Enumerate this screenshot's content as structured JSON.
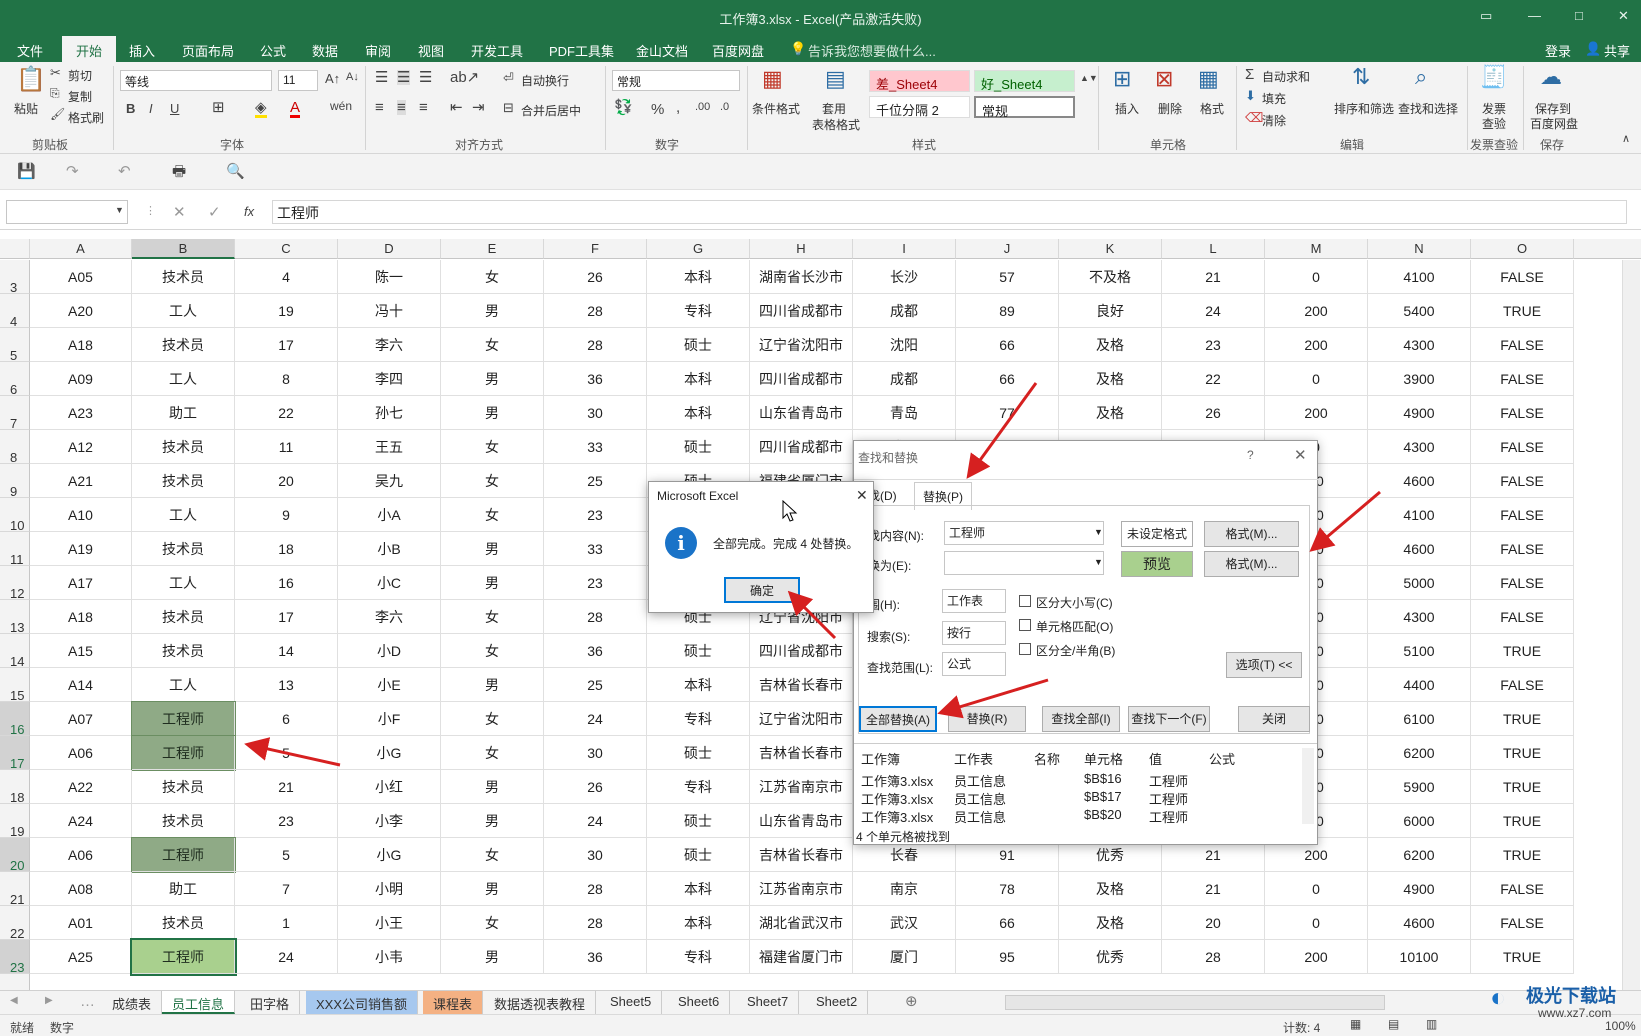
{
  "window": {
    "title": "工作簿3.xlsx - Excel(产品激活失败)"
  },
  "menu": {
    "tabs": [
      "文件",
      "开始",
      "插入",
      "页面布局",
      "公式",
      "数据",
      "审阅",
      "视图",
      "开发工具",
      "PDF工具集",
      "金山文档",
      "百度网盘"
    ],
    "tellme": "告诉我您想要做什么...",
    "login": "登录",
    "share": "共享"
  },
  "ribbon": {
    "clipboard": {
      "paste": "粘贴",
      "cut": "剪切",
      "copy": "复制",
      "format_painter": "格式刷",
      "group": "剪贴板"
    },
    "font": {
      "name": "等线",
      "size": "11",
      "bold": "B",
      "italic": "I",
      "underline": "U",
      "group": "字体"
    },
    "align": {
      "wrap": "自动换行",
      "merge": "合并后居中",
      "group": "对齐方式"
    },
    "number": {
      "format": "常规",
      "pct": "%",
      "comma": ",",
      "group": "数字"
    },
    "styles": {
      "cond": "条件格式",
      "table1": "套用",
      "table2": "表格格式",
      "bad": "差_Sheet4",
      "good": "好_Sheet4",
      "thousand": "千位分隔 2",
      "normal": "常规",
      "group": "样式"
    },
    "cells": {
      "insert": "插入",
      "delete": "删除",
      "format": "格式",
      "group": "单元格"
    },
    "editing": {
      "autosum": "自动求和",
      "fill": "填充",
      "clear": "清除",
      "sort": "排序和筛选",
      "find": "查找和选择",
      "group": "编辑"
    },
    "invoice": {
      "l1": "发票",
      "l2": "查验",
      "group": "发票查验"
    },
    "save": {
      "l1": "保存到",
      "l2": "百度网盘",
      "group": "保存"
    }
  },
  "formula_bar": {
    "name_box": "",
    "fx": "fx",
    "value": "工程师"
  },
  "columns": [
    "A",
    "B",
    "C",
    "D",
    "E",
    "F",
    "G",
    "H",
    "I",
    "J",
    "K",
    "L",
    "M",
    "N",
    "O"
  ],
  "rows": [
    {
      "n": "3",
      "c": [
        "A05",
        "技术员",
        "4",
        "陈一",
        "女",
        "26",
        "本科",
        "湖南省长沙市",
        "长沙",
        "57",
        "不及格",
        "21",
        "0",
        "4100",
        "FALSE"
      ]
    },
    {
      "n": "4",
      "c": [
        "A20",
        "工人",
        "19",
        "冯十",
        "男",
        "28",
        "专科",
        "四川省成都市",
        "成都",
        "89",
        "良好",
        "24",
        "200",
        "5400",
        "TRUE"
      ]
    },
    {
      "n": "5",
      "c": [
        "A18",
        "技术员",
        "17",
        "李六",
        "女",
        "28",
        "硕士",
        "辽宁省沈阳市",
        "沈阳",
        "66",
        "及格",
        "23",
        "200",
        "4300",
        "FALSE"
      ]
    },
    {
      "n": "6",
      "c": [
        "A09",
        "工人",
        "8",
        "李四",
        "男",
        "36",
        "本科",
        "四川省成都市",
        "成都",
        "66",
        "及格",
        "22",
        "0",
        "3900",
        "FALSE"
      ]
    },
    {
      "n": "7",
      "c": [
        "A23",
        "助工",
        "22",
        "孙七",
        "男",
        "30",
        "本科",
        "山东省青岛市",
        "青岛",
        "77",
        "及格",
        "26",
        "200",
        "4900",
        "FALSE"
      ]
    },
    {
      "n": "8",
      "c": [
        "A12",
        "技术员",
        "11",
        "王五",
        "女",
        "33",
        "硕士",
        "四川省成都市",
        "成都",
        "",
        "",
        "",
        "0",
        "4300",
        "FALSE"
      ]
    },
    {
      "n": "9",
      "c": [
        "A21",
        "技术员",
        "20",
        "吴九",
        "女",
        "25",
        "硕士",
        "福建省厦门市",
        "",
        "",
        "",
        "",
        "00",
        "4600",
        "FALSE"
      ]
    },
    {
      "n": "10",
      "c": [
        "A10",
        "工人",
        "9",
        "小A",
        "女",
        "23",
        "",
        "",
        "",
        "",
        "",
        "",
        "00",
        "4100",
        "FALSE"
      ]
    },
    {
      "n": "11",
      "c": [
        "A19",
        "技术员",
        "18",
        "小B",
        "男",
        "33",
        "",
        "",
        "",
        "",
        "",
        "",
        "00",
        "4600",
        "FALSE"
      ]
    },
    {
      "n": "12",
      "c": [
        "A17",
        "工人",
        "16",
        "小C",
        "男",
        "23",
        "",
        "",
        "",
        "",
        "",
        "",
        "00",
        "5000",
        "FALSE"
      ]
    },
    {
      "n": "13",
      "c": [
        "A18",
        "技术员",
        "17",
        "李六",
        "女",
        "28",
        "硕士",
        "辽宁省沈阳市",
        "",
        "",
        "",
        "",
        "00",
        "4300",
        "FALSE"
      ]
    },
    {
      "n": "14",
      "c": [
        "A15",
        "技术员",
        "14",
        "小D",
        "女",
        "36",
        "硕士",
        "四川省成都市",
        "",
        "",
        "",
        "",
        "00",
        "5100",
        "TRUE"
      ]
    },
    {
      "n": "15",
      "c": [
        "A14",
        "工人",
        "13",
        "小E",
        "男",
        "25",
        "本科",
        "吉林省长春市",
        "",
        "",
        "",
        "",
        "00",
        "4400",
        "FALSE"
      ]
    },
    {
      "n": "16",
      "c": [
        "A07",
        "工程师",
        "6",
        "小F",
        "女",
        "24",
        "专科",
        "辽宁省沈阳市",
        "",
        "",
        "",
        "",
        "00",
        "6100",
        "TRUE"
      ]
    },
    {
      "n": "17",
      "c": [
        "A06",
        "工程师",
        "5",
        "小G",
        "女",
        "30",
        "硕士",
        "吉林省长春市",
        "",
        "",
        "",
        "",
        "00",
        "6200",
        "TRUE"
      ]
    },
    {
      "n": "18",
      "c": [
        "A22",
        "技术员",
        "21",
        "小红",
        "男",
        "26",
        "专科",
        "江苏省南京市",
        "",
        "",
        "",
        "",
        "00",
        "5900",
        "TRUE"
      ]
    },
    {
      "n": "19",
      "c": [
        "A24",
        "技术员",
        "23",
        "小李",
        "男",
        "24",
        "硕士",
        "山东省青岛市",
        "",
        "",
        "",
        "",
        "00",
        "6000",
        "TRUE"
      ]
    },
    {
      "n": "20",
      "c": [
        "A06",
        "工程师",
        "5",
        "小G",
        "女",
        "30",
        "硕士",
        "吉林省长春市",
        "长春",
        "91",
        "优秀",
        "21",
        "200",
        "6200",
        "TRUE"
      ]
    },
    {
      "n": "21",
      "c": [
        "A08",
        "助工",
        "7",
        "小明",
        "男",
        "28",
        "本科",
        "江苏省南京市",
        "南京",
        "78",
        "及格",
        "21",
        "0",
        "4900",
        "FALSE"
      ]
    },
    {
      "n": "22",
      "c": [
        "A01",
        "技术员",
        "1",
        "小王",
        "女",
        "28",
        "本科",
        "湖北省武汉市",
        "武汉",
        "66",
        "及格",
        "20",
        "0",
        "4600",
        "FALSE"
      ]
    },
    {
      "n": "23",
      "c": [
        "A25",
        "工程师",
        "24",
        "小韦",
        "男",
        "36",
        "专科",
        "福建省厦门市",
        "厦门",
        "95",
        "优秀",
        "28",
        "200",
        "10100",
        "TRUE"
      ]
    }
  ],
  "sheets": [
    "成绩表",
    "员工信息",
    "田字格",
    "XXX公司销售额",
    "课程表",
    "数据透视表教程",
    "Sheet5",
    "Sheet6",
    "Sheet7",
    "Sheet2"
  ],
  "status": {
    "ready": "就绪",
    "mode": "数字",
    "count": "计数: 4",
    "zoom": "100%"
  },
  "find_replace": {
    "title": "查找和替换",
    "help": "?",
    "tab_find": "查找(D)",
    "tab_replace": "替换(P)",
    "find_label": "查找内容(N):",
    "find_value": "工程师",
    "no_format": "未设定格式",
    "format_btn": "格式(M)...",
    "replace_label": "替换为(E):",
    "replace_value": "",
    "preview": "预览",
    "format_btn2": "格式(M)...",
    "scope_label": "范围(H):",
    "scope": "工作表",
    "search_label": "搜索(S):",
    "search": "按行",
    "lookin_label": "查找范围(L):",
    "lookin": "公式",
    "match_case": "区分大小写(C)",
    "match_cell": "单元格匹配(O)",
    "match_width": "区分全/半角(B)",
    "options": "选项(T) <<",
    "replace_all": "全部替换(A)",
    "replace": "替换(R)",
    "find_all": "查找全部(I)",
    "find_next": "查找下一个(F)",
    "close": "关闭",
    "result_headers": [
      "工作簿",
      "工作表",
      "名称",
      "单元格",
      "值",
      "公式"
    ],
    "results": [
      [
        "工作簿3.xlsx",
        "员工信息",
        "",
        "$B$16",
        "工程师",
        ""
      ],
      [
        "工作簿3.xlsx",
        "员工信息",
        "",
        "$B$17",
        "工程师",
        ""
      ],
      [
        "工作簿3.xlsx",
        "员工信息",
        "",
        "$B$20",
        "工程师",
        ""
      ]
    ],
    "status": "4 个单元格被找到"
  },
  "message": {
    "title": "Microsoft Excel",
    "text": "全部完成。完成 4 处替换。",
    "ok": "确定"
  },
  "watermark": {
    "text": "极光下载站",
    "url": "www.xz7.com"
  }
}
